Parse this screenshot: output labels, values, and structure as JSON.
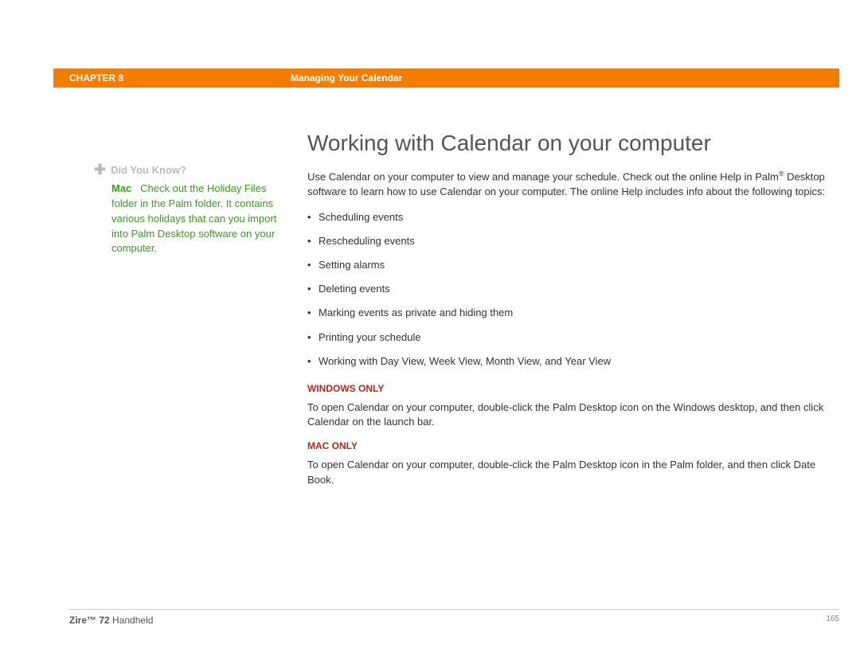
{
  "header": {
    "chapter": "CHAPTER 8",
    "topic": "Managing Your Calendar"
  },
  "sidebar": {
    "dyk_label": "Did You Know?",
    "mac_label": "Mac",
    "body_line1": "Check out the Holiday Files folder in the Palm folder. It contains various holidays that can you import into Palm Desktop software on your computer."
  },
  "main": {
    "title": "Working with Calendar on your computer",
    "intro_a": "Use Calendar on your computer to view and manage your schedule. Check out the online Help in Palm",
    "intro_b": " Desktop software to learn how to use Calendar on your computer. The online Help includes info about the following topics:",
    "bullets": [
      "Scheduling events",
      "Rescheduling events",
      "Setting alarms",
      "Deleting events",
      "Marking events as private and hiding them",
      "Printing your schedule",
      "Working with Day View, Week View, Month View, and Year View"
    ],
    "win_heading": "WINDOWS ONLY",
    "win_body": "To open Calendar on your computer, double-click the Palm Desktop icon on the Windows desktop, and then click Calendar on the launch bar.",
    "mac_heading": "MAC ONLY",
    "mac_body": "To open Calendar on your computer, double-click the Palm Desktop icon in the Palm folder, and then click Date Book."
  },
  "footer": {
    "product_bold": "Zire™ 72",
    "product_rest": " Handheld",
    "page": "165"
  }
}
